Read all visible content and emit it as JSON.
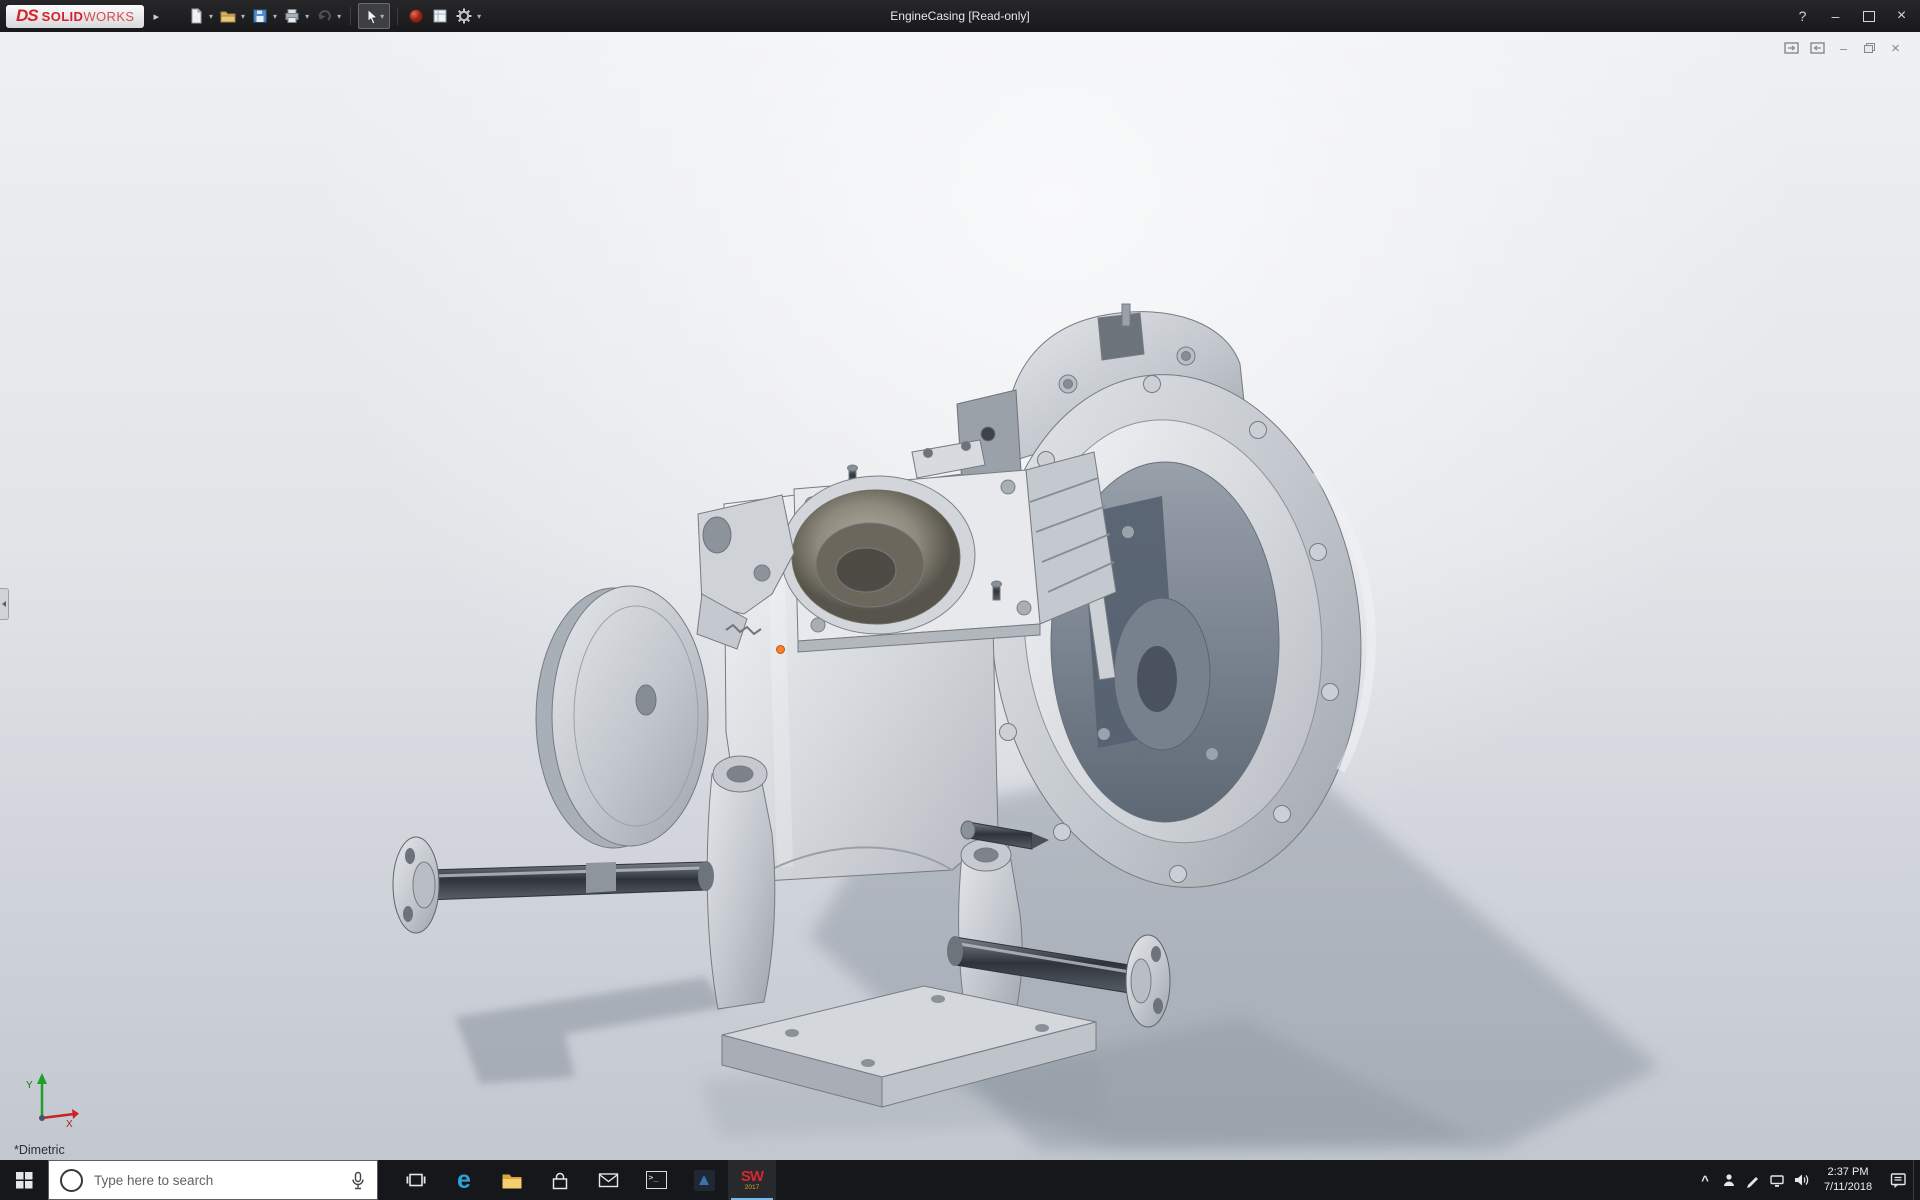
{
  "titlebar": {
    "brand_ds": "DS",
    "brand_bold": "SOLID",
    "brand_light": "WORKS",
    "flyout": "▸",
    "dropdown": "▾",
    "title": "EngineCasing [Read-only]",
    "help": "?",
    "minimize": "–",
    "close": "×"
  },
  "viewport": {
    "doc_minimize": "–",
    "doc_close": "×",
    "view_orientation": "*Dimetric",
    "triad_x": "X",
    "triad_y": "Y"
  },
  "taskbar": {
    "search_placeholder": "Type here to search",
    "edge_glyph": "e",
    "console_glyph": "&gt;_",
    "sw_letters": "SW",
    "sw_year": "2017",
    "tray_expand": "^",
    "time": "2:37 PM",
    "date": "7/11/2018"
  },
  "colors": {
    "brand_red": "#d2232a",
    "selection_orange": "#ff7f27",
    "titlebar_bg": "#1d1d1f",
    "taskbar_bg": "#15171b",
    "viewport_top": "#f0f1f3",
    "viewport_bottom": "#c3c8d0"
  }
}
